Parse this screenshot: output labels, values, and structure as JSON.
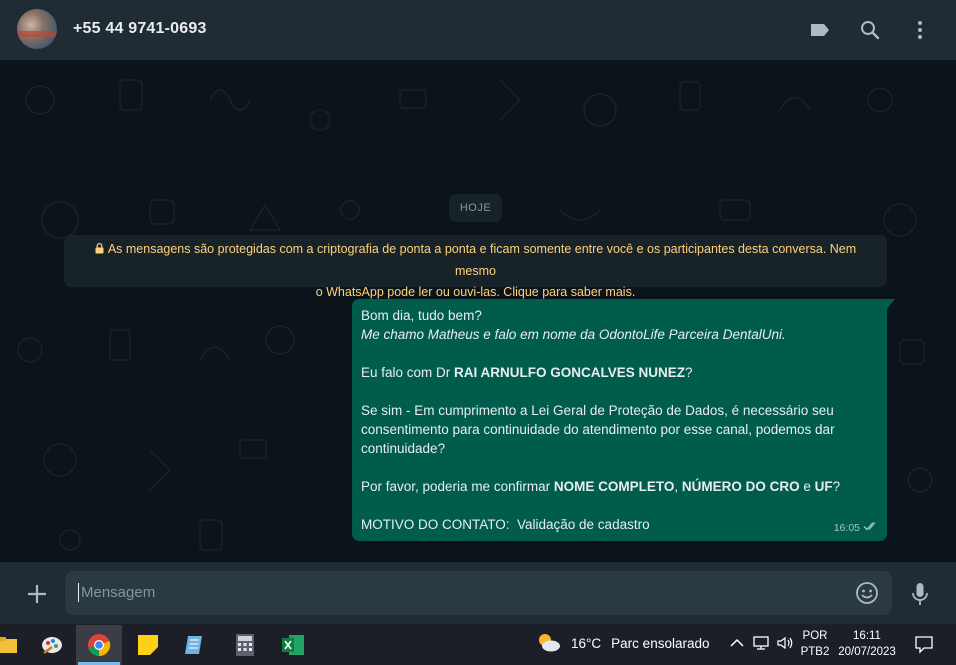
{
  "header": {
    "contact_name": "+55 44 9741-0693",
    "icons": [
      "label-icon",
      "search-icon",
      "more-vertical-icon"
    ]
  },
  "chat": {
    "date_chip": "HOJE",
    "encryption_notice_line1": "As mensagens são protegidas com a criptografia de ponta a ponta e ficam somente entre você e os participantes desta conversa. Nem mesmo",
    "encryption_notice_line2": "o WhatsApp pode ler ou ouvi-las. Clique para saber mais.",
    "message": {
      "line1": "Bom dia, tudo bem?",
      "line2_italic": "Me chamo Matheus e falo em nome da OdontoLife Parceira DentalUni.",
      "q_prefix": "Eu falo com Dr ",
      "q_name": "RAI ARNULFO GONCALVES NUNEZ",
      "q_suffix": "?",
      "lgpd_line1": "Se sim - Em cumprimento a Lei Geral de Proteção de Dados, é necessário seu",
      "lgpd_line2": "consentimento para continuidade do atendimento por esse canal, podemos dar",
      "lgpd_line3": "continuidade?",
      "confirm_prefix": "Por favor, poderia me confirmar ",
      "confirm_b1": "NOME COMPLETO",
      "confirm_sep": ", ",
      "confirm_b2": "NÚMERO DO CRO",
      "confirm_and": " e ",
      "confirm_b3": "UF",
      "confirm_suffix": "?",
      "reason": "MOTIVO DO CONTATO:  Validação de cadastro",
      "time": "16:05",
      "status": "read"
    }
  },
  "composer": {
    "placeholder": "Mensagem"
  },
  "taskbar": {
    "apps": [
      "file-explorer-icon",
      "paint-icon",
      "chrome-icon",
      "sticky-notes-icon",
      "notepad-icon",
      "calculator-icon",
      "excel-icon"
    ],
    "active_app": "chrome-icon",
    "weather_temp": "16°C",
    "weather_text": "Parc ensolarado",
    "lang_line1": "POR",
    "lang_line2": "PTB2",
    "time": "16:11",
    "date": "20/07/2023"
  },
  "colors": {
    "header_bg": "#202c33",
    "chat_bg": "#0b141a",
    "outgoing_bubble": "#005c4b",
    "encryption_text": "#ffd279",
    "taskbar_bg": "#1c1f27"
  }
}
